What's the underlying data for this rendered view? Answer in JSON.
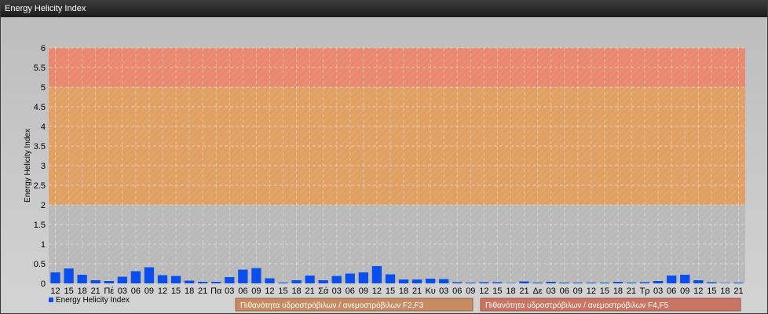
{
  "window": {
    "title": "Energy Helicity Index"
  },
  "chart_data": {
    "type": "bar",
    "ylabel": "Energy Helicity Index",
    "ylim": [
      0,
      6
    ],
    "yticks": [
      "0",
      "0.5",
      "1",
      "1.5",
      "2",
      "2.5",
      "3",
      "3.5",
      "4",
      "4.5",
      "5",
      "5.5",
      "6"
    ],
    "categories": [
      "12",
      "15",
      "18",
      "21",
      "Πέ",
      "03",
      "06",
      "09",
      "12",
      "15",
      "18",
      "21",
      "Πα",
      "03",
      "06",
      "09",
      "12",
      "15",
      "18",
      "21",
      "Σά",
      "03",
      "06",
      "09",
      "12",
      "15",
      "18",
      "21",
      "Κυ",
      "03",
      "06",
      "09",
      "12",
      "15",
      "18",
      "21",
      "Δε",
      "03",
      "06",
      "09",
      "12",
      "15",
      "18",
      "21",
      "Τρ",
      "03",
      "06",
      "09",
      "12",
      "15",
      "18",
      "21"
    ],
    "series": [
      {
        "name": "Energy Helicity Index",
        "color": "#0a4ef0",
        "values": [
          0.28,
          0.38,
          0.22,
          0.08,
          0.06,
          0.17,
          0.31,
          0.41,
          0.21,
          0.19,
          0.07,
          0.04,
          0.04,
          0.16,
          0.35,
          0.39,
          0.13,
          0.02,
          0.08,
          0.2,
          0.08,
          0.19,
          0.25,
          0.28,
          0.44,
          0.23,
          0.1,
          0.1,
          0.12,
          0.11,
          0.03,
          0.02,
          0.03,
          0.03,
          0.01,
          0.05,
          0.02,
          0.04,
          0.02,
          0.02,
          0.02,
          0.02,
          0.04,
          0.02,
          0.03,
          0.06,
          0.2,
          0.22,
          0.08,
          0.03,
          0.01,
          0.02
        ]
      }
    ],
    "bands": [
      {
        "from": 2,
        "to": 5,
        "color": "#e0a064"
      },
      {
        "from": 5,
        "to": 6,
        "color": "#e88870"
      }
    ],
    "grid": true,
    "legend": {
      "series_label": "Energy Helicity Index",
      "band_labels": [
        "Πιθανότητα υδροστρόβιλων / ανεμοστρόβιλων F2,F3",
        "Πιθανότητα υδροστρόβιλων / ανεμοστρόβιλων F4,F5"
      ]
    }
  }
}
